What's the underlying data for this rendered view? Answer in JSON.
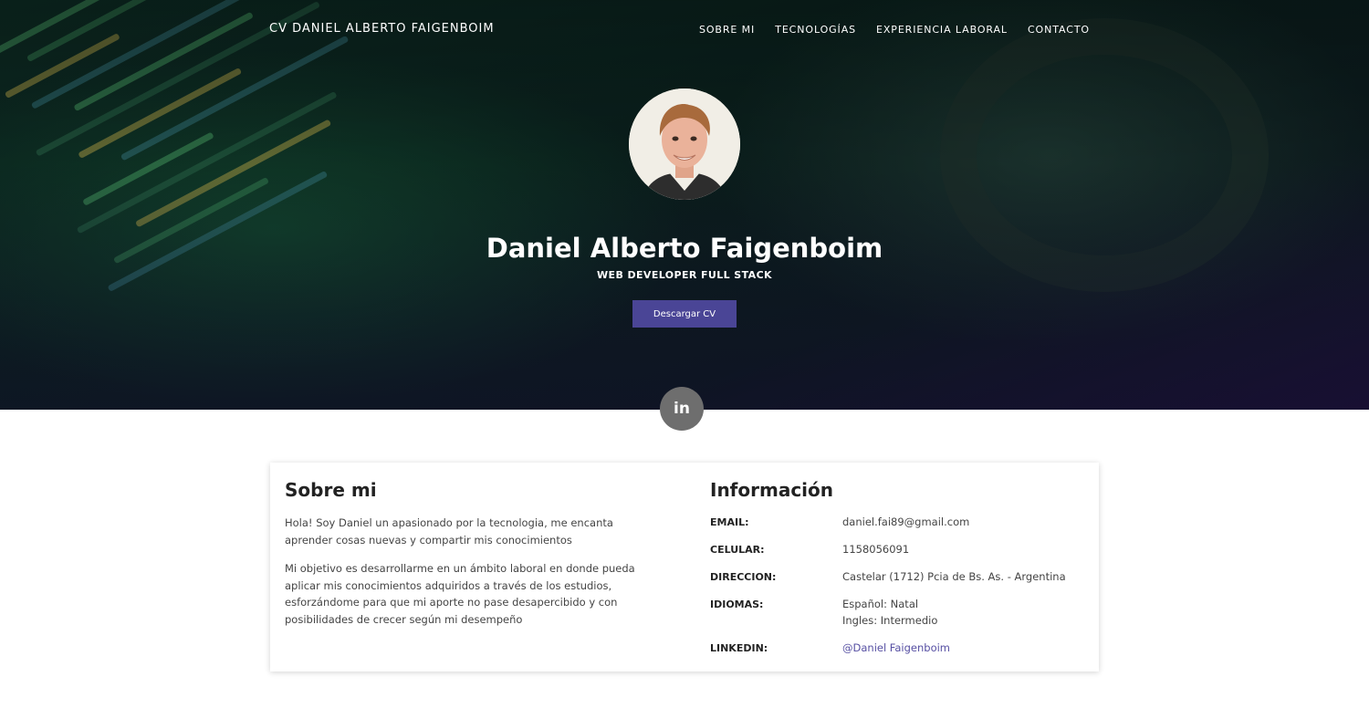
{
  "nav": {
    "brand": "CV DANIEL ALBERTO FAIGENBOIM",
    "links": [
      "SOBRE MI",
      "TECNOLOGÍAS",
      "EXPERIENCIA LABORAL",
      "CONTACTO"
    ]
  },
  "hero": {
    "name": "Daniel Alberto Faigenboim",
    "title": "WEB DEVELOPER FULL STACK",
    "download_label": "Descargar CV",
    "linkedin_icon_text": "in"
  },
  "about": {
    "heading": "Sobre mi",
    "paragraphs": [
      "Hola! Soy Daniel un apasionado por la tecnologia, me encanta aprender cosas nuevas y compartir mis conocimientos",
      "Mi objetivo es desarrollarme en un ámbito laboral en donde pueda aplicar mis conocimientos adquiridos a través de los estudios, esforzándome para que mi aporte no pase desapercibido y con posibilidades de crecer según mi desempeño"
    ]
  },
  "info": {
    "heading": "Información",
    "email_label": "EMAIL:",
    "email": "daniel.fai89@gmail.com",
    "phone_label": "CELULAR:",
    "phone": "1158056091",
    "address_label": "DIRECCION:",
    "address": "Castelar (1712) Pcia de Bs. As. - Argentina",
    "languages_label": "IDIOMAS:",
    "languages": [
      "Español: Natal",
      "Ingles: Intermedio"
    ],
    "linkedin_label": "LINKEDIN:",
    "linkedin": "@Daniel Faigenboim"
  },
  "colors": {
    "accent": "#4a4596",
    "link": "#5750a3",
    "social_button": "#6e6e6e"
  },
  "icons": {
    "social": "linkedin-icon",
    "avatar": "profile-photo"
  }
}
